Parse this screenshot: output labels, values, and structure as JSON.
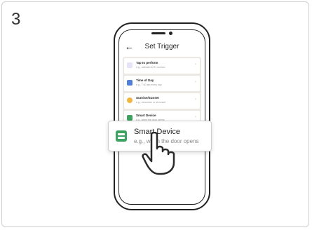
{
  "step_number": "3",
  "header": {
    "back_glyph": "←",
    "title": "Set Trigger"
  },
  "items": [
    {
      "title": "Tap to perform",
      "subtitle": "e.g., activate All Tv scenes",
      "icon": "tap-icon",
      "color": "#8f80d8"
    },
    {
      "title": "Time of Day",
      "subtitle": "e.g., 7:00 am every day",
      "icon": "calendar-icon",
      "color": "#4f7fd6"
    },
    {
      "title": "Sunrise/Sunset",
      "subtitle": "e.g., at sunrise or at sunset",
      "icon": "sun-icon",
      "color": "#f0b640"
    },
    {
      "title": "Smart Device",
      "subtitle": "e.g., when the door opens",
      "icon": "device-icon",
      "color": "#3ea360"
    }
  ],
  "popup": {
    "title": "Smart Device",
    "subtitle": "e.g., when the door opens",
    "icon": "device-icon",
    "color": "#3ea360"
  },
  "chevron_glyph": "›"
}
